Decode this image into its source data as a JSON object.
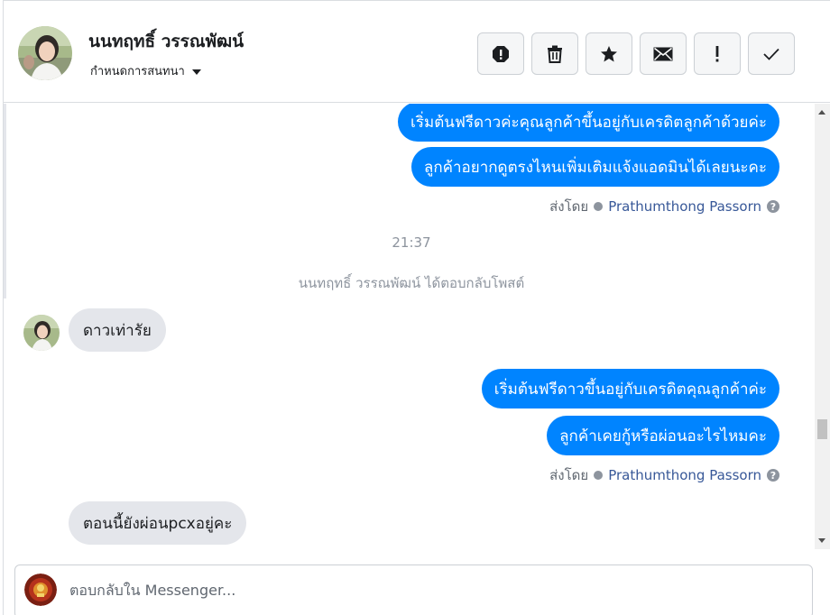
{
  "header": {
    "contact_name": "นนทฤทธิ์ วรรณพัฒน์",
    "assign_label": "กำหนดการสนทนา",
    "actions": [
      {
        "icon": "alert-octagon-icon",
        "name": "spam-button"
      },
      {
        "icon": "trash-icon",
        "name": "delete-button"
      },
      {
        "icon": "star-icon",
        "name": "star-button"
      },
      {
        "icon": "envelope-icon",
        "name": "mark-unread-button"
      },
      {
        "icon": "exclamation-icon",
        "name": "follow-up-button"
      },
      {
        "icon": "check-icon",
        "name": "mark-done-button"
      }
    ]
  },
  "messages": {
    "out1": "เริ่มต้นฟรีดาวค่ะคุณลูกค้าขึ้นอยู่กับเครดิตลูกค้าด้วยค่ะ",
    "out2": "ลูกค้าอยากดูตรงไหนเพิ่มเติมแจ้งแอดมินได้เลยนะคะ",
    "sent_by_label_1": "ส่งโดย",
    "sender_1": "Prathumthong Passorn",
    "time": "21:37",
    "system_note": "นนทฤทธิ์ วรรณพัฒน์ ได้ตอบกลับโพสต์",
    "in1": "ดาวเท่ารัย",
    "out3": "เริ่มต้นฟรีดาวขึ้นอยู่กับเครดิตคุณลูกค้าค่ะ",
    "out4": "ลูกค้าเคยกู้หรือผ่อนอะไรไหมคะ",
    "sent_by_label_2": "ส่งโดย",
    "sender_2": "Prathumthong Passorn",
    "in2": "ตอนนี้ยังผ่อนpcxอยู่คะ"
  },
  "composer": {
    "placeholder": "ตอบกลับใน Messenger..."
  },
  "colors": {
    "outgoing_bubble": "#0084ff",
    "incoming_bubble": "#e4e6eb",
    "sender_link": "#385898"
  }
}
